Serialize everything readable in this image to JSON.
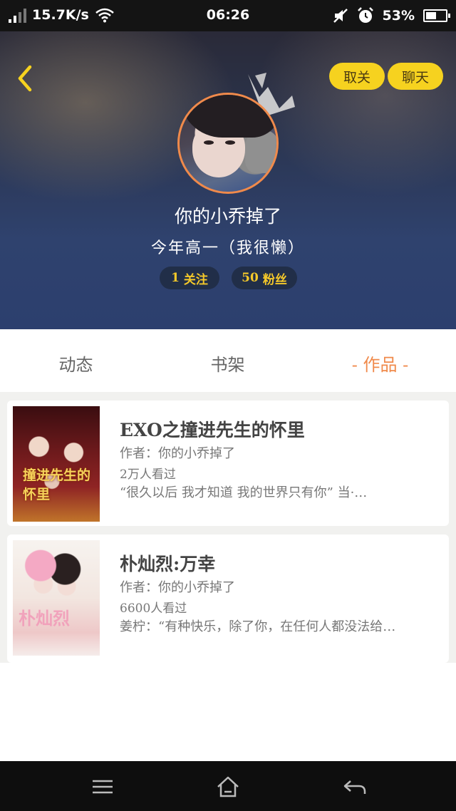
{
  "status_bar": {
    "speed": "15.7K/s",
    "time": "06:26",
    "battery_text": "53%",
    "battery_level": 0.53
  },
  "profile": {
    "unfollow_label": "取关",
    "chat_label": "聊天",
    "nickname": "你的小乔掉了",
    "bio": "今年高一（我很懒）",
    "following_count": "1",
    "following_label": "关注",
    "fans_count": "50",
    "fans_label": "粉丝"
  },
  "tabs": [
    {
      "label": "动态"
    },
    {
      "label": "书架"
    },
    {
      "label": "- 作品 -"
    }
  ],
  "works": [
    {
      "title": "EXO之撞进先生的怀里",
      "author": "作者：你的小乔掉了",
      "views": "2万人看过",
      "desc": "“很久以后 我才知道 我的世界只有你”  当·…",
      "cover_text": "撞进先生的怀里"
    },
    {
      "title": "朴灿烈:万幸",
      "author": "作者：你的小乔掉了",
      "views": "6600人看过",
      "desc": "姜柠：“有种快乐，除了你，在任何人都没法给…",
      "cover_text": "朴灿烈"
    }
  ],
  "colors": {
    "accent": "#f08a4b",
    "button_yellow": "#f6d21f",
    "stat_text": "#f4c82a"
  }
}
